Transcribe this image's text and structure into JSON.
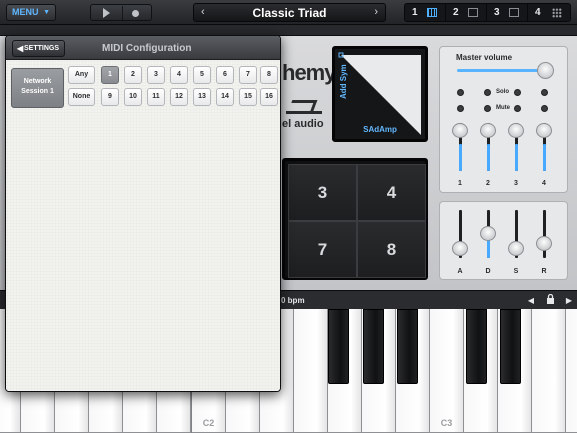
{
  "topbar": {
    "menu_label": "MENU",
    "patch_name": "Classic Triad",
    "prev_arrow": "‹",
    "next_arrow": "›",
    "slots": [
      {
        "label": "1",
        "active": true
      },
      {
        "label": "2",
        "active": false
      },
      {
        "label": "3",
        "active": false
      },
      {
        "label": "4",
        "active": false
      }
    ]
  },
  "synth": {
    "logo_text": "hemy",
    "logo_sub": "el audio",
    "xy_pad": {
      "y_label": "Add Sym",
      "x_label": "SAdAmp"
    },
    "pads": [
      "3",
      "4",
      "7",
      "8"
    ],
    "mixer": {
      "title": "Master volume",
      "solo_label": "Solo",
      "mute_label": "Mute",
      "channels": [
        "1",
        "2",
        "3",
        "4"
      ],
      "channel_levels": [
        0.45,
        0.45,
        0.45,
        0.45
      ],
      "master_level": 1.0
    },
    "envelope": {
      "labels": [
        "A",
        "D",
        "S",
        "R"
      ],
      "levels": [
        0.15,
        0.55,
        0.15,
        0.25
      ]
    },
    "status": {
      "bpm_text": "0 bpm"
    }
  },
  "keyboard": {
    "labels": {
      "c2": "C2",
      "c3": "C3"
    }
  },
  "midi_config": {
    "back_label": "SETTINGS",
    "title": "MIDI Configuration",
    "session_label": "Network Session 1",
    "any_label": "Any",
    "none_label": "None",
    "channels_row1": [
      "1",
      "2",
      "3",
      "4",
      "5",
      "6",
      "7",
      "8"
    ],
    "channels_row2": [
      "9",
      "10",
      "11",
      "12",
      "13",
      "14",
      "15",
      "16"
    ],
    "selected_channel": "1"
  },
  "colors": {
    "accent": "#4fb0ff",
    "panel": "#d1d2d4",
    "popover_bg": "#f2f2ef"
  }
}
